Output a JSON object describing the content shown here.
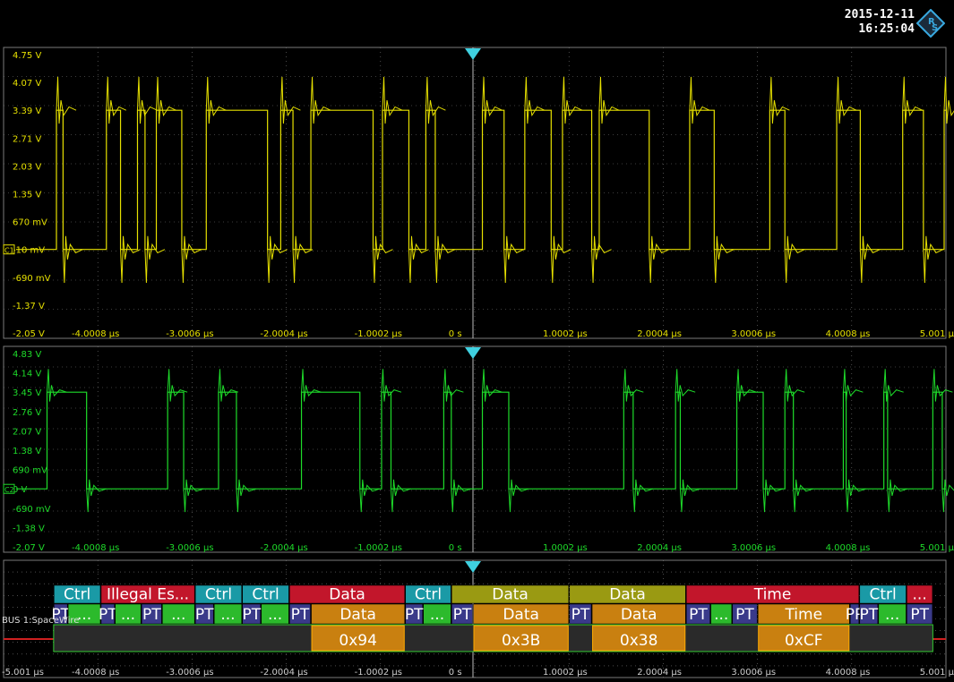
{
  "header": {
    "date": "2015-12-11",
    "time": "16:25:04",
    "logo_icon": "rohde-schwarz-logo-icon"
  },
  "colors": {
    "ch1": "#e6e000",
    "ch2": "#1edc2a",
    "grid": "#7a7a7a",
    "trigger": "#3fd0e0",
    "bus_ctrl": "#1a9aa6",
    "bus_illegal": "#c2162b",
    "bus_data_red": "#c2162b",
    "bus_data_olive": "#9a9a12",
    "bus_time": "#c2162b",
    "bus_pt": "#3a3a8a",
    "bus_inner": "#c98010",
    "bus_green": "#2cba2c"
  },
  "channel1": {
    "marker": "C1",
    "y_labels": [
      "4.75 V",
      "4.07 V",
      "3.39 V",
      "2.71 V",
      "2.03 V",
      "1.35 V",
      "670 mV",
      "-10 mV",
      "-690 mV",
      "-1.37 V",
      "-2.05 V"
    ],
    "x_labels": [
      "-4.0008 µs",
      "-3.0006 µs",
      "-2.0004 µs",
      "-1.0002 µs",
      "0 s",
      "1.0002 µs",
      "2.0004 µs",
      "3.0006 µs",
      "4.0008 µs",
      "5.001 µs"
    ],
    "high_v": 3.39,
    "low_v": -0.01,
    "transitions_us": [
      -4.42,
      -4.35,
      -3.89,
      -3.74,
      -3.56,
      -3.48,
      -3.36,
      -3.09,
      -2.83,
      -2.18,
      -2.04,
      -1.91,
      -1.72,
      -1.06,
      -0.96,
      -0.68,
      -0.5,
      -0.4,
      0.1,
      0.33,
      0.55,
      0.83,
      0.95,
      1.26,
      1.34,
      1.87,
      2.3,
      2.56,
      3.15,
      3.31,
      3.86,
      4.11,
      4.56,
      4.78,
      5.0
    ]
  },
  "channel2": {
    "marker": "C2",
    "y_labels": [
      "4.83 V",
      "4.14 V",
      "3.45 V",
      "2.76 V",
      "2.07 V",
      "1.38 V",
      "690 mV",
      "0 V",
      "-690 mV",
      "-1.38 V",
      "-2.07 V"
    ],
    "x_labels": [
      "-4.0008 µs",
      "-3.0006 µs",
      "-2.0004 µs",
      "-1.0002 µs",
      "0 s",
      "1.0002 µs",
      "2.0004 µs",
      "3.0006 µs",
      "4.0008 µs",
      "5.001 µs"
    ],
    "high_v": 3.45,
    "low_v": 0.0,
    "transitions_us": [
      -4.52,
      -4.1,
      -3.24,
      -3.07,
      -2.7,
      -2.51,
      -1.82,
      -1.2,
      -0.97,
      -0.87,
      -0.31,
      -0.23,
      0.1,
      0.38,
      1.6,
      1.7,
      2.15,
      2.2,
      2.8,
      3.08,
      3.31,
      3.4,
      3.93,
      3.96,
      4.36,
      4.4,
      4.88,
      4.98
    ]
  },
  "bus": {
    "label": "BUS 1:SpaceWire",
    "x_labels": [
      "-5.001 µs",
      "-4.0008 µs",
      "-3.0006 µs",
      "-2.0004 µs",
      "-1.0002 µs",
      "0 s",
      "1.0002 µs",
      "2.0004 µs",
      "3.0006 µs",
      "4.0008 µs",
      "5.001 µs"
    ],
    "top_row": [
      {
        "text": "Ctrl",
        "start_us": -4.45,
        "end_us": -3.95,
        "kind": "ctrl"
      },
      {
        "text": "Illegal Es...",
        "start_us": -3.95,
        "end_us": -2.95,
        "kind": "illegal"
      },
      {
        "text": "Ctrl",
        "start_us": -2.95,
        "end_us": -2.45,
        "kind": "ctrl"
      },
      {
        "text": "Ctrl",
        "start_us": -2.45,
        "end_us": -1.95,
        "kind": "ctrl"
      },
      {
        "text": "Data",
        "start_us": -1.95,
        "end_us": -0.72,
        "kind": "data_red"
      },
      {
        "text": "Ctrl",
        "start_us": -0.72,
        "end_us": -0.23,
        "kind": "ctrl"
      },
      {
        "text": "Data",
        "start_us": -0.23,
        "end_us": 1.02,
        "kind": "data_olive"
      },
      {
        "text": "Data",
        "start_us": 1.02,
        "end_us": 2.26,
        "kind": "data_olive"
      },
      {
        "text": "Time",
        "start_us": 2.26,
        "end_us": 4.1,
        "kind": "time"
      },
      {
        "text": "Ctrl",
        "start_us": 4.1,
        "end_us": 4.6,
        "kind": "ctrl"
      },
      {
        "text": "...",
        "start_us": 4.6,
        "end_us": 4.88,
        "kind": "time"
      }
    ],
    "mid_row": [
      {
        "text": "PT",
        "start_us": -4.45,
        "end_us": -4.3,
        "kind": "pt"
      },
      {
        "text": "...",
        "start_us": -4.3,
        "end_us": -3.95,
        "kind": "green"
      },
      {
        "text": "PT",
        "start_us": -3.95,
        "end_us": -3.8,
        "kind": "pt"
      },
      {
        "text": "...",
        "start_us": -3.8,
        "end_us": -3.52,
        "kind": "green"
      },
      {
        "text": "PT",
        "start_us": -3.52,
        "end_us": -3.3,
        "kind": "pt"
      },
      {
        "text": "...",
        "start_us": -3.3,
        "end_us": -2.95,
        "kind": "green"
      },
      {
        "text": "PT",
        "start_us": -2.95,
        "end_us": -2.75,
        "kind": "pt"
      },
      {
        "text": "...",
        "start_us": -2.75,
        "end_us": -2.45,
        "kind": "green"
      },
      {
        "text": "PT",
        "start_us": -2.45,
        "end_us": -2.25,
        "kind": "pt"
      },
      {
        "text": "...",
        "start_us": -2.25,
        "end_us": -1.95,
        "kind": "green"
      },
      {
        "text": "PT",
        "start_us": -1.95,
        "end_us": -1.72,
        "kind": "pt"
      },
      {
        "text": "Data",
        "start_us": -1.72,
        "end_us": -0.72,
        "kind": "inner"
      },
      {
        "text": "PT",
        "start_us": -0.72,
        "end_us": -0.53,
        "kind": "pt"
      },
      {
        "text": "...",
        "start_us": -0.53,
        "end_us": -0.23,
        "kind": "green"
      },
      {
        "text": "PT",
        "start_us": -0.23,
        "end_us": 0.0,
        "kind": "pt"
      },
      {
        "text": "Data",
        "start_us": 0.0,
        "end_us": 1.02,
        "kind": "inner"
      },
      {
        "text": "PT",
        "start_us": 1.02,
        "end_us": 1.26,
        "kind": "pt"
      },
      {
        "text": "Data",
        "start_us": 1.26,
        "end_us": 2.26,
        "kind": "inner"
      },
      {
        "text": "PT",
        "start_us": 2.26,
        "end_us": 2.52,
        "kind": "pt"
      },
      {
        "text": "...",
        "start_us": 2.52,
        "end_us": 2.75,
        "kind": "green"
      },
      {
        "text": "PT",
        "start_us": 2.75,
        "end_us": 3.02,
        "kind": "pt"
      },
      {
        "text": "Time",
        "start_us": 3.02,
        "end_us": 4.0,
        "kind": "inner"
      },
      {
        "text": "PP",
        "start_us": 4.0,
        "end_us": 4.1,
        "kind": "pt"
      },
      {
        "text": "PT",
        "start_us": 4.1,
        "end_us": 4.3,
        "kind": "pt"
      },
      {
        "text": "...",
        "start_us": 4.3,
        "end_us": 4.6,
        "kind": "green"
      },
      {
        "text": "PT",
        "start_us": 4.6,
        "end_us": 4.88,
        "kind": "pt"
      }
    ],
    "bottom_row": [
      {
        "text": "0x94",
        "start_us": -1.72,
        "end_us": -0.72
      },
      {
        "text": "0x3B",
        "start_us": 0.0,
        "end_us": 1.02
      },
      {
        "text": "0x38",
        "start_us": 1.26,
        "end_us": 2.26
      },
      {
        "text": "0xCF",
        "start_us": 3.02,
        "end_us": 4.0
      }
    ]
  }
}
